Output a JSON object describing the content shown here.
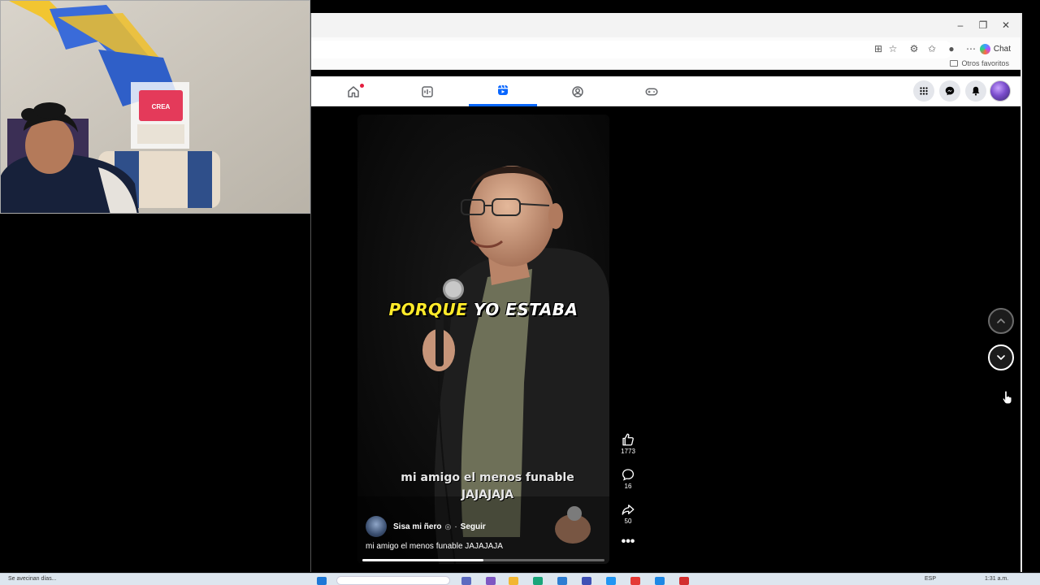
{
  "webcam": {
    "poster_text": "CREA"
  },
  "browser": {
    "chat_label": "Chat",
    "favorites_label": "Otros favoritos"
  },
  "facebook_nav": {
    "tabs": [
      {
        "name": "home",
        "icon": "home-icon",
        "notification": true
      },
      {
        "name": "video",
        "icon": "video-icon"
      },
      {
        "name": "reels",
        "icon": "reels-icon",
        "active": true
      },
      {
        "name": "groups",
        "icon": "groups-icon"
      },
      {
        "name": "gaming",
        "icon": "gaming-icon"
      }
    ],
    "right_icons": [
      "menu-grid-icon",
      "messenger-icon",
      "bell-icon",
      "profile-avatar"
    ]
  },
  "reel": {
    "caption_highlight": "PORQUE",
    "caption_rest": "YO ESTABA",
    "overlay_text_line1": "mi amigo el menos funable",
    "overlay_text_line2": "JAJAJAJA",
    "author_name": "Sisa mi ñero",
    "follow_label": "Seguir",
    "follow_separator": "·",
    "description": "mi amigo el menos funable JAJAJAJA",
    "progress_fraction": 0.5
  },
  "actions": {
    "likes": "1773",
    "comments": "16",
    "shares": "50"
  },
  "taskbar": {
    "status_text": "Se avecinan días...",
    "language": "ESP",
    "time": "1:31 a.m."
  },
  "colors": {
    "accent": "#0866ff",
    "caption_highlight": "#ffea2a",
    "notification": "#e41e3f"
  }
}
